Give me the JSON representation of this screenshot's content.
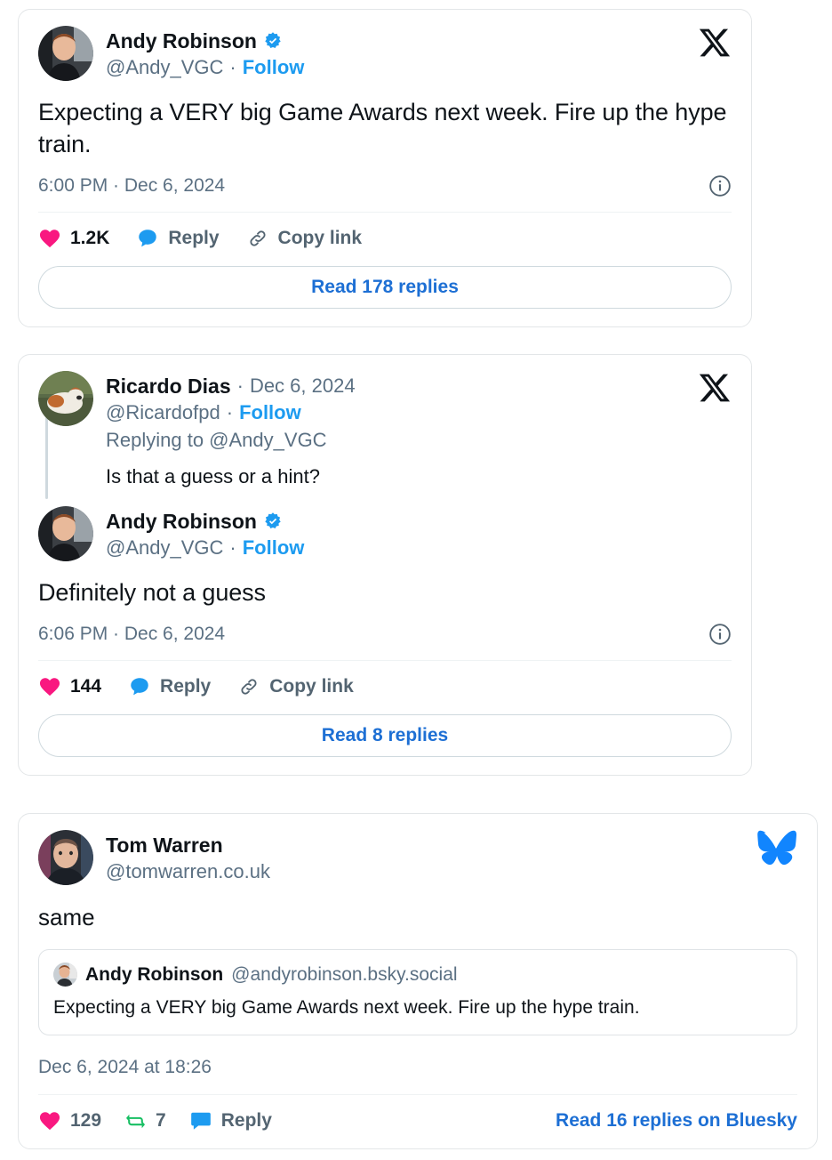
{
  "colors": {
    "like_pink": "#F91880",
    "reply_blue": "#1D9BF0",
    "repost_green": "#17BF63",
    "link_blue": "#1D6FD4",
    "bluesky_blue": "#1185FE",
    "verified_blue": "#1D9BF0",
    "text_primary": "#0F1419",
    "text_muted": "#5B7083",
    "card_border": "#E3E6E8"
  },
  "posts": [
    {
      "platform": "x",
      "brand_icon": "x-logo-icon",
      "author": {
        "name": "Andy Robinson",
        "handle": "@Andy_VGC",
        "verified": true,
        "follow_label": "Follow",
        "separator": "·"
      },
      "text": "Expecting a VERY big Game Awards next week. Fire up the hype train.",
      "timestamp": "6:00 PM · Dec 6, 2024",
      "info_icon": "info-circle-icon",
      "actions": {
        "like": {
          "icon": "heart-icon",
          "count": "1.2K"
        },
        "reply": {
          "icon": "reply-bubble-icon",
          "label": "Reply"
        },
        "copy": {
          "icon": "link-icon",
          "label": "Copy link"
        }
      },
      "read_replies": "Read 178 replies"
    },
    {
      "platform": "x",
      "brand_icon": "x-logo-icon",
      "thread": {
        "author": {
          "name": "Ricardo Dias",
          "date": "Dec 6, 2024",
          "handle": "@Ricardofpd",
          "follow_label": "Follow",
          "separator": "·"
        },
        "replying_to": "Replying to @Andy_VGC",
        "text": "Is that a guess or a hint?"
      },
      "author": {
        "name": "Andy Robinson",
        "handle": "@Andy_VGC",
        "verified": true,
        "follow_label": "Follow",
        "separator": "·"
      },
      "text": "Definitely not a guess",
      "timestamp": "6:06 PM · Dec 6, 2024",
      "info_icon": "info-circle-icon",
      "actions": {
        "like": {
          "icon": "heart-icon",
          "count": "144"
        },
        "reply": {
          "icon": "reply-bubble-icon",
          "label": "Reply"
        },
        "copy": {
          "icon": "link-icon",
          "label": "Copy link"
        }
      },
      "read_replies": "Read 8 replies"
    },
    {
      "platform": "bluesky",
      "brand_icon": "bluesky-butterfly-icon",
      "author": {
        "name": "Tom Warren",
        "handle": "@tomwarren.co.uk"
      },
      "text": "same",
      "quote": {
        "name": "Andy Robinson",
        "handle": "@andyrobinson.bsky.social",
        "text": "Expecting a VERY big Game Awards next week. Fire up the hype train."
      },
      "timestamp": "Dec 6, 2024 at 18:26",
      "actions": {
        "like": {
          "icon": "heart-icon",
          "count": "129"
        },
        "repost": {
          "icon": "repost-icon",
          "count": "7"
        },
        "reply": {
          "icon": "reply-bubble-icon",
          "label": "Reply"
        }
      },
      "read_replies": "Read 16 replies on Bluesky"
    }
  ]
}
